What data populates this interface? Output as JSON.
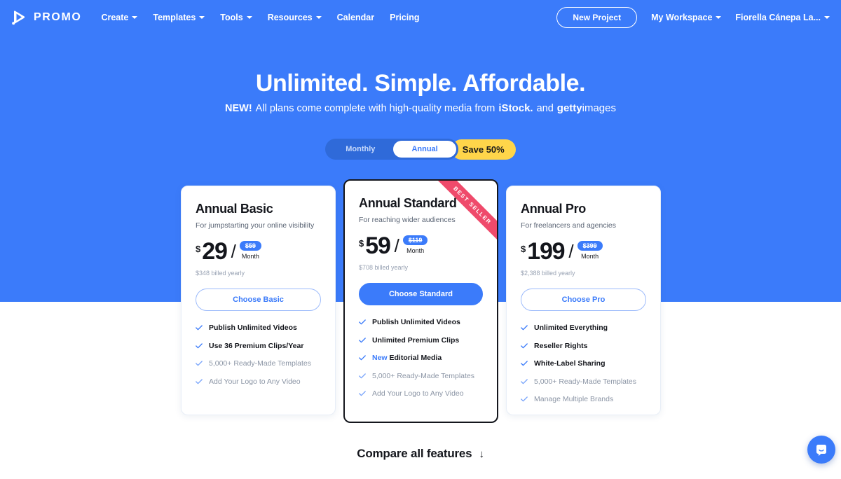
{
  "navbar": {
    "logo_text": "PROMO",
    "links": [
      {
        "label": "Create",
        "has_caret": true
      },
      {
        "label": "Templates",
        "has_caret": true
      },
      {
        "label": "Tools",
        "has_caret": true
      },
      {
        "label": "Resources",
        "has_caret": true
      },
      {
        "label": "Calendar",
        "has_caret": false
      },
      {
        "label": "Pricing",
        "has_caret": false
      }
    ],
    "new_project": "New Project",
    "workspace": "My Workspace",
    "account": "Fiorella Cánepa La..."
  },
  "hero": {
    "title": "Unlimited. Simple. Affordable.",
    "sub_flag": "NEW!",
    "sub_text": "All plans come complete with high-quality media from",
    "brand_one": "iStock.",
    "conjunction": "and",
    "brand_two_bold": "getty",
    "brand_two_light": "images"
  },
  "billing_toggle": {
    "monthly": "Monthly",
    "annual": "Annual",
    "selected": "Annual",
    "save_badge": "Save 50%"
  },
  "plans": [
    {
      "id": "basic",
      "title": "Annual Basic",
      "description": "For jumpstarting your online visibility",
      "currency": "$",
      "price": "29",
      "separator": "/",
      "old_price": "$59",
      "period": "Month",
      "billed": "$348 billed yearly",
      "cta": "Choose Basic",
      "ribbon": null,
      "features": [
        {
          "text": "Publish Unlimited Videos",
          "emphasis": "strong"
        },
        {
          "text": "Use 36 Premium Clips/Year",
          "emphasis": "strong"
        },
        {
          "text": "5,000+ Ready-Made Templates",
          "emphasis": "muted"
        },
        {
          "text": "Add Your Logo to Any Video",
          "emphasis": "muted"
        }
      ]
    },
    {
      "id": "standard",
      "title": "Annual Standard",
      "description": "For reaching wider audiences",
      "currency": "$",
      "price": "59",
      "separator": "/",
      "old_price": "$119",
      "period": "Month",
      "billed": "$708 billed yearly",
      "cta": "Choose Standard",
      "ribbon": "BEST SELLER",
      "features": [
        {
          "text": "Publish Unlimited Videos",
          "emphasis": "strong"
        },
        {
          "text": "Unlimited Premium Clips",
          "emphasis": "strong"
        },
        {
          "text": "Editorial Media",
          "emphasis": "strong",
          "tag": "New"
        },
        {
          "text": "5,000+ Ready-Made Templates",
          "emphasis": "muted"
        },
        {
          "text": "Add Your Logo to Any Video",
          "emphasis": "muted"
        }
      ]
    },
    {
      "id": "pro",
      "title": "Annual Pro",
      "description": "For freelancers and agencies",
      "currency": "$",
      "price": "199",
      "separator": "/",
      "old_price": "$399",
      "period": "Month",
      "billed": "$2,388 billed yearly",
      "cta": "Choose Pro",
      "ribbon": null,
      "features": [
        {
          "text": "Unlimited Everything",
          "emphasis": "strong"
        },
        {
          "text": "Reseller Rights",
          "emphasis": "strong"
        },
        {
          "text": "White-Label Sharing",
          "emphasis": "strong"
        },
        {
          "text": "5,000+ Ready-Made Templates",
          "emphasis": "muted"
        },
        {
          "text": "Manage Multiple Brands",
          "emphasis": "muted"
        }
      ]
    }
  ],
  "compare": {
    "label": "Compare all features",
    "arrow": "↓"
  },
  "chat": {
    "icon": "chat-icon"
  },
  "colors": {
    "brand_blue": "#3b7bfa",
    "ribbon_pink": "#ef4a6b",
    "save_yellow": "#ffd54a",
    "ink": "#14161c",
    "muted": "#8b95a5"
  }
}
